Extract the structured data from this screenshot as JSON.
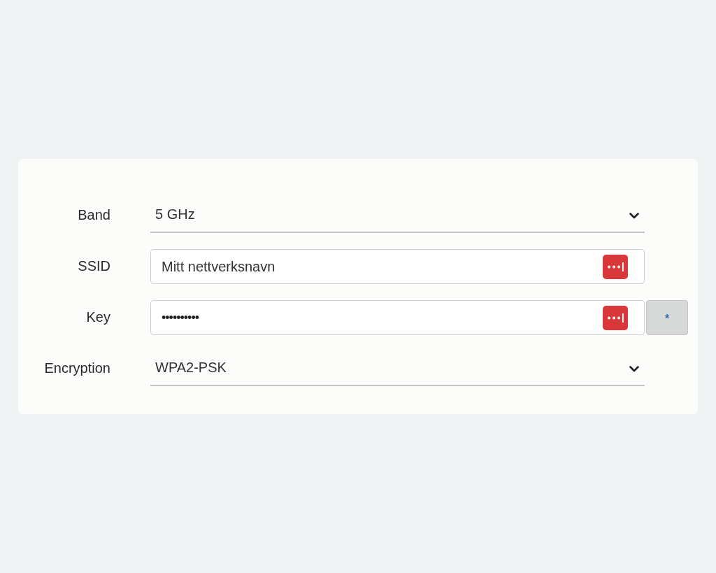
{
  "fields": [
    {
      "kind": "select",
      "label": "Band",
      "value": "5 GHz"
    },
    {
      "kind": "text",
      "label": "SSID",
      "value": "Mitt nettverksnavn"
    },
    {
      "kind": "password",
      "label": "Key",
      "value": "••••••••••",
      "reveal_button": "*"
    },
    {
      "kind": "select",
      "label": "Encryption",
      "value": "WPA2-PSK"
    }
  ]
}
